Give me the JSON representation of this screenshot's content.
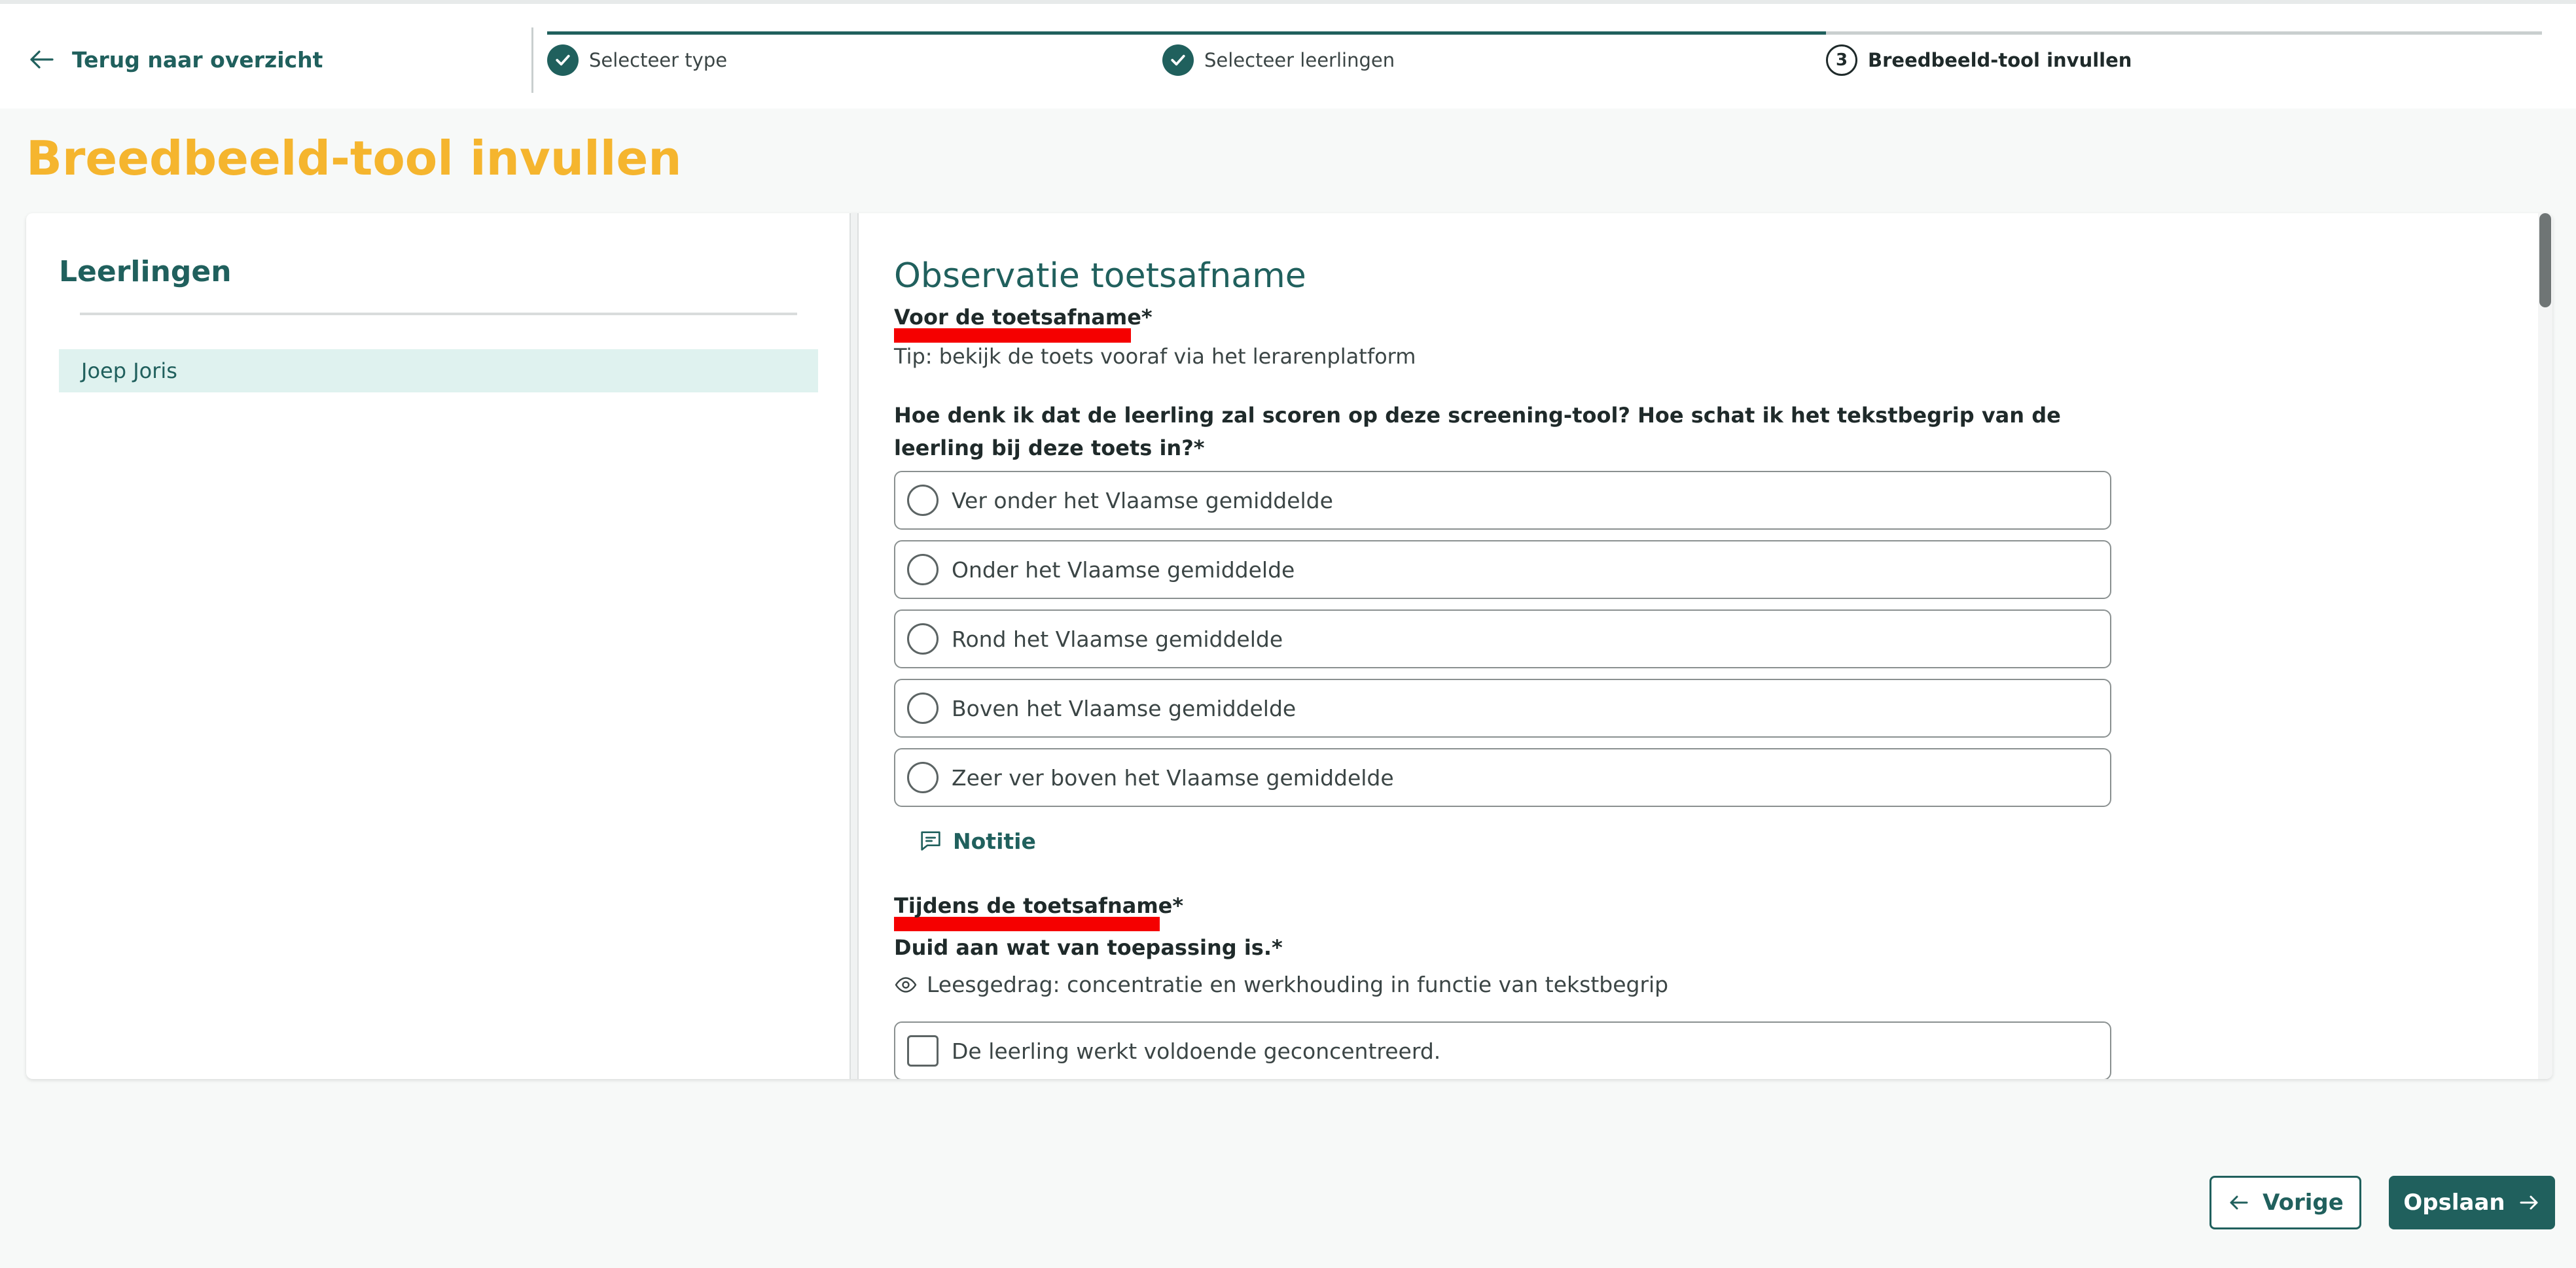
{
  "header": {
    "back_label": "Terug naar overzicht",
    "steps": [
      {
        "label": "Selecteer type",
        "state": "done"
      },
      {
        "label": "Selecteer leerlingen",
        "state": "done"
      },
      {
        "number": "3",
        "label": "Breedbeeld-tool invullen",
        "state": "current"
      }
    ]
  },
  "page_title": "Breedbeeld-tool invullen",
  "students": {
    "title": "Leerlingen",
    "items": [
      "Joep Joris"
    ]
  },
  "form": {
    "section_title": "Observatie toetsafname",
    "before": {
      "label": "Voor de toetsafname*",
      "tip": "Tip: bekijk de toets vooraf via het lerarenplatform",
      "question": "Hoe denk ik dat de leerling zal scoren op deze screening-tool? Hoe schat ik het tekstbegrip van de leerling bij deze toets in?*",
      "options": [
        "Ver onder het Vlaamse gemiddelde",
        "Onder het Vlaamse gemiddelde",
        "Rond het Vlaamse gemiddelde",
        "Boven het Vlaamse gemiddelde",
        "Zeer ver boven het Vlaamse gemiddelde"
      ],
      "note_label": "Notitie"
    },
    "during": {
      "label": "Tijdens de toetsafname*",
      "instruction": "Duid aan wat van toepassing is.*",
      "hint": "Leesgedrag: concentratie en werkhouding in functie van tekstbegrip",
      "checkbox_options": [
        "De leerling werkt voldoende geconcentreerd."
      ]
    }
  },
  "footer": {
    "prev_label": "Vorige",
    "save_label": "Opslaan"
  },
  "colors": {
    "primary": "#20605d",
    "title": "#f5b52e",
    "highlight": "#f50000",
    "selected_bg": "#dff2ef"
  }
}
